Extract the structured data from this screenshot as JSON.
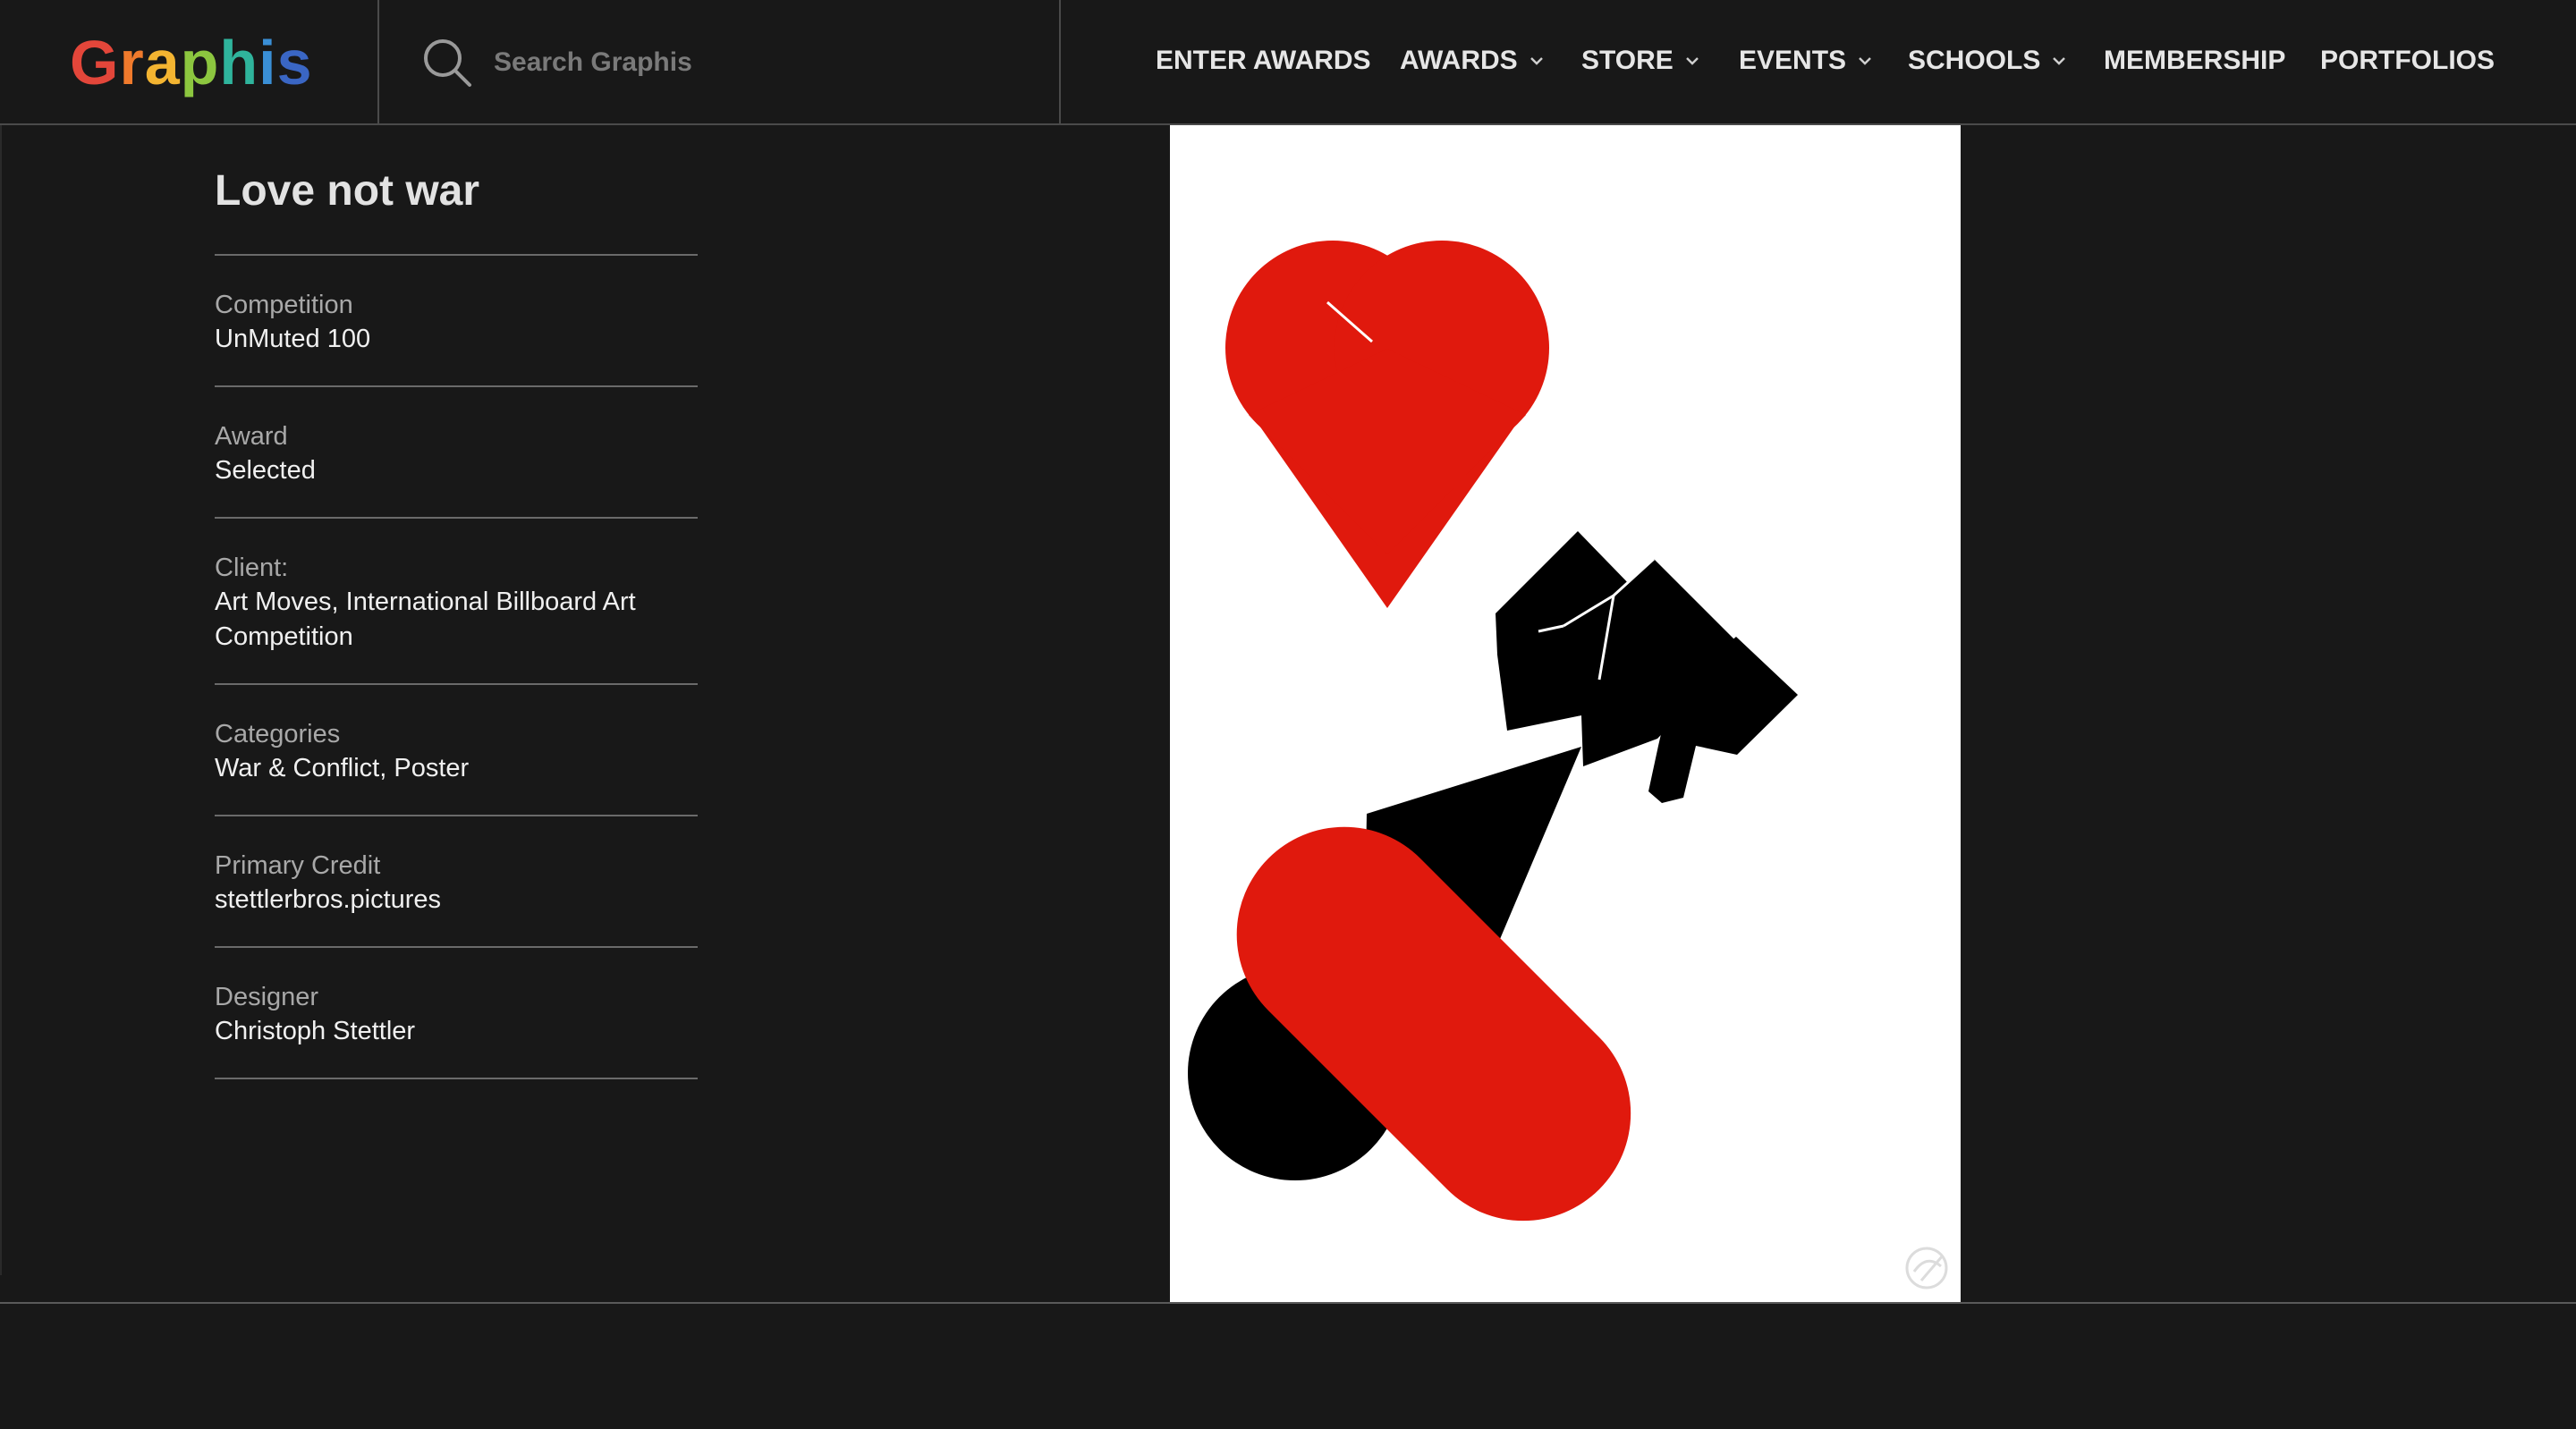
{
  "header": {
    "logo_text": "Graphis",
    "logo_letters": [
      "G",
      "r",
      "a",
      "p",
      "h",
      "i",
      "s"
    ],
    "logo_colors": [
      "#e3463a",
      "#f07a2c",
      "#f3b431",
      "#8cc63f",
      "#2fb49c",
      "#3a8fd6",
      "#3a66c4"
    ],
    "search_placeholder": "Search Graphis",
    "search_icon": "search-icon"
  },
  "nav": {
    "items": [
      {
        "label": "ENTER AWARDS",
        "has_dropdown": false
      },
      {
        "label": "AWARDS",
        "has_dropdown": true
      },
      {
        "label": "STORE",
        "has_dropdown": true
      },
      {
        "label": "EVENTS",
        "has_dropdown": true
      },
      {
        "label": "SCHOOLS",
        "has_dropdown": true
      },
      {
        "label": "MEMBERSHIP",
        "has_dropdown": false
      },
      {
        "label": "PORTFOLIOS",
        "has_dropdown": false
      }
    ]
  },
  "entry": {
    "title": "Love not war",
    "fields": [
      {
        "label": "Competition",
        "value": "UnMuted 100"
      },
      {
        "label": "Award",
        "value": "Selected"
      },
      {
        "label": "Client:",
        "value_lines": [
          "Art Moves, International Billboard Art",
          "Competition"
        ]
      },
      {
        "label": "Categories",
        "value": "War & Conflict, Poster"
      },
      {
        "label": "Primary Credit",
        "value": "stettlerbros.pictures"
      },
      {
        "label": "Designer",
        "value": "Christoph Stettler"
      }
    ]
  },
  "poster": {
    "description_icon": "heart-and-bomb-poster",
    "colors": {
      "red": "#e0190d",
      "black": "#000000",
      "background": "#ffffff"
    },
    "watermark_icon": "graphis-watermark-icon"
  }
}
